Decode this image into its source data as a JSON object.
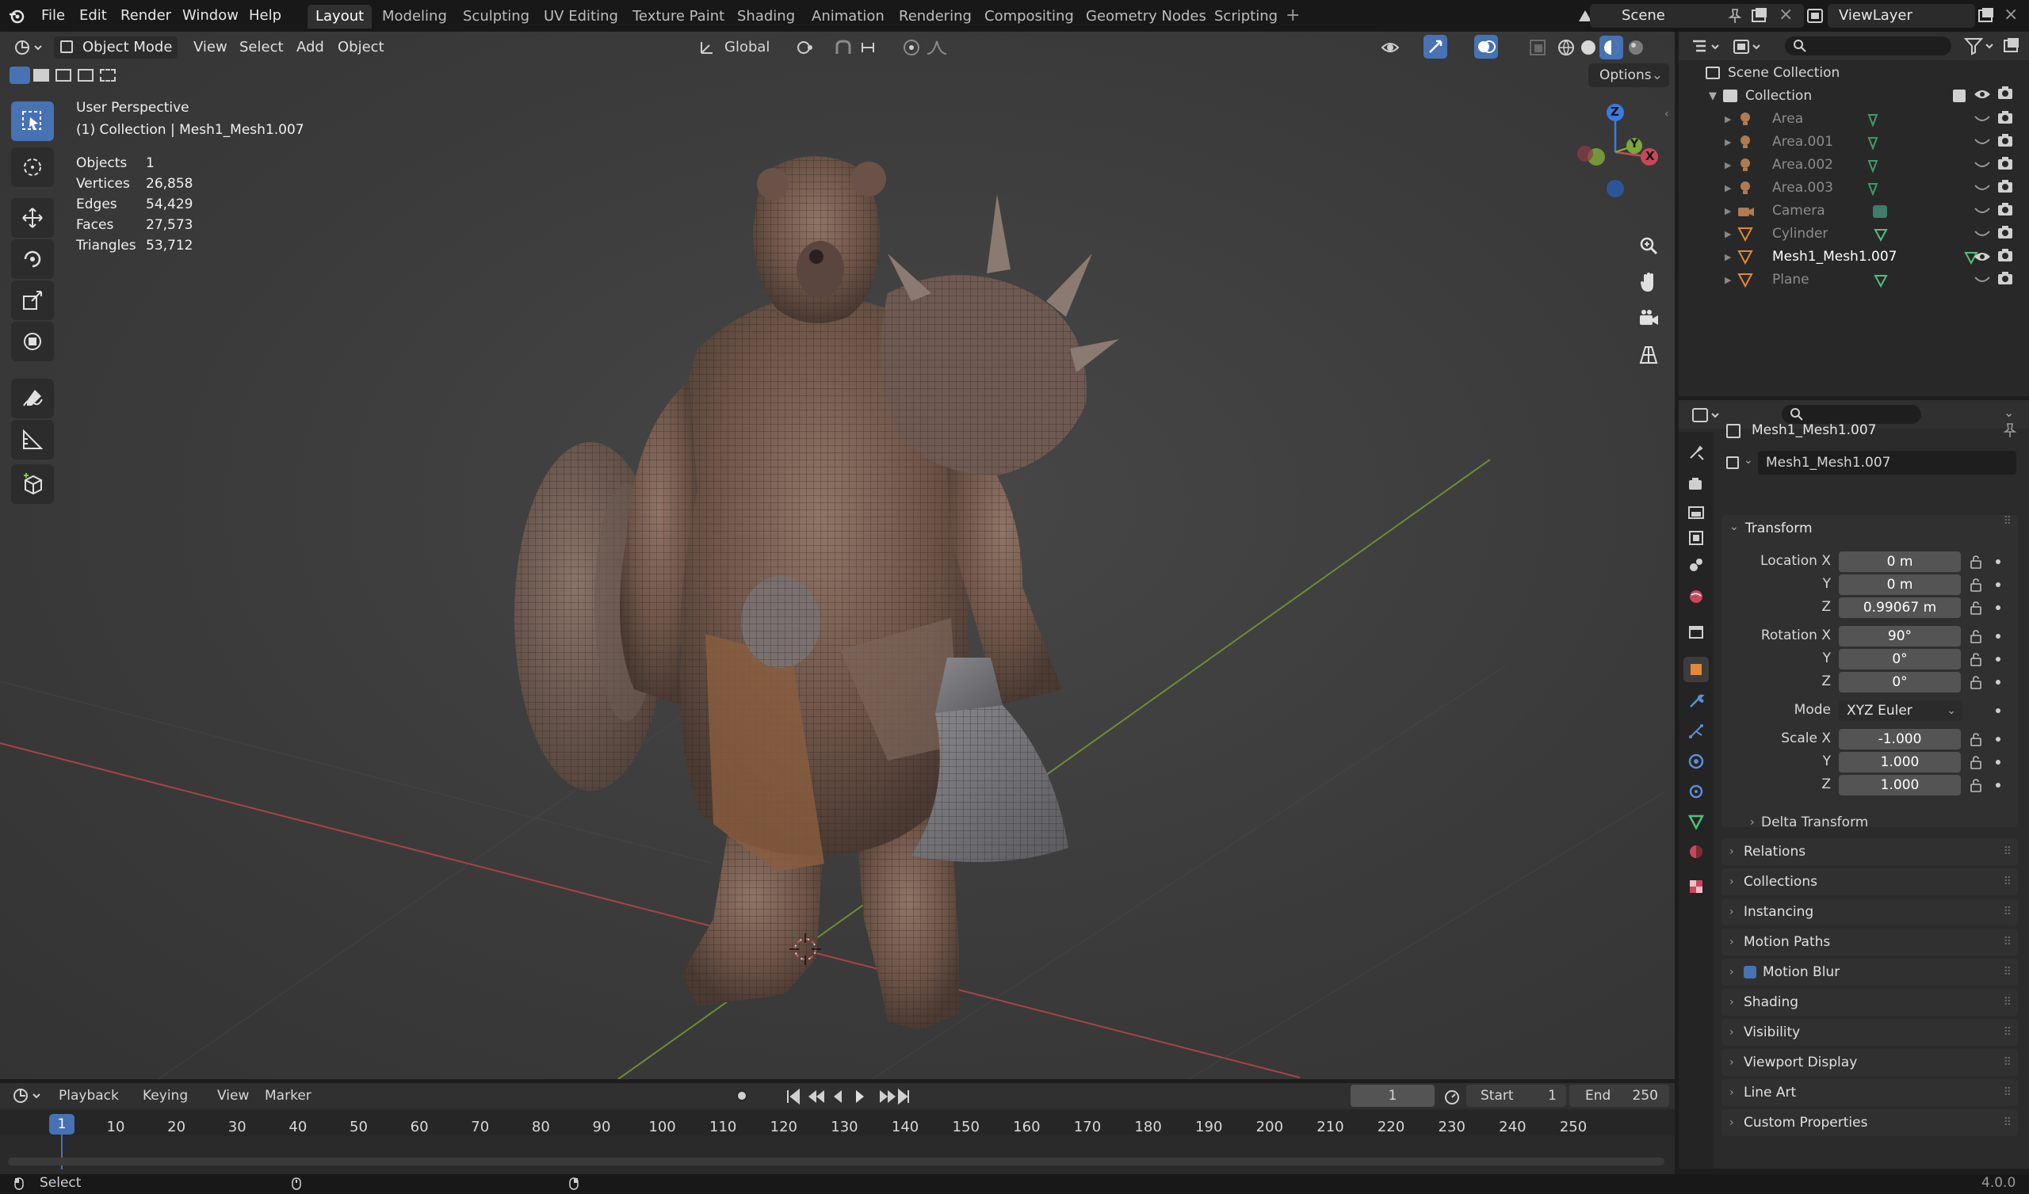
{
  "menu": {
    "file": "File",
    "edit": "Edit",
    "render": "Render",
    "window": "Window",
    "help": "Help"
  },
  "workspaces": [
    "Layout",
    "Modeling",
    "Sculpting",
    "UV Editing",
    "Texture Paint",
    "Shading",
    "Animation",
    "Rendering",
    "Compositing",
    "Geometry Nodes",
    "Scripting"
  ],
  "active_workspace": "Layout",
  "scene": {
    "label": "Scene"
  },
  "view_layer": {
    "label": "ViewLayer"
  },
  "viewport": {
    "mode": "Object Mode",
    "menus": [
      "View",
      "Select",
      "Add",
      "Object"
    ],
    "orientation": "Global",
    "options_label": "Options",
    "overlay_title": "User Perspective",
    "overlay_sub": "(1) Collection | Mesh1_Mesh1.007",
    "stats": [
      {
        "label": "Objects",
        "value": "1"
      },
      {
        "label": "Vertices",
        "value": "26,858"
      },
      {
        "label": "Edges",
        "value": "54,429"
      },
      {
        "label": "Faces",
        "value": "27,573"
      },
      {
        "label": "Triangles",
        "value": "53,712"
      }
    ],
    "gizmo": {
      "x": "X",
      "y": "Y",
      "z": "Z"
    }
  },
  "outliner": {
    "root": "Scene Collection",
    "collection": "Collection",
    "items": [
      {
        "name": "Area",
        "type": "light"
      },
      {
        "name": "Area.001",
        "type": "light"
      },
      {
        "name": "Area.002",
        "type": "light"
      },
      {
        "name": "Area.003",
        "type": "light"
      },
      {
        "name": "Camera",
        "type": "camera"
      },
      {
        "name": "Cylinder",
        "type": "mesh"
      },
      {
        "name": "Mesh1_Mesh1.007",
        "type": "mesh",
        "active": true
      },
      {
        "name": "Plane",
        "type": "mesh"
      }
    ]
  },
  "properties": {
    "object_name": "Mesh1_Mesh1.007",
    "data_name": "Mesh1_Mesh1.007",
    "transform_label": "Transform",
    "location": {
      "label": "Location X",
      "x": "0 m",
      "y": "0 m",
      "z": "0.99067 m"
    },
    "rotation": {
      "label": "Rotation X",
      "x": "90°",
      "y": "0°",
      "z": "0°"
    },
    "mode": {
      "label": "Mode",
      "value": "XYZ Euler"
    },
    "scale": {
      "label": "Scale X",
      "x": "-1.000",
      "y": "1.000",
      "z": "1.000"
    },
    "axis_y": "Y",
    "axis_z": "Z",
    "delta_transform": "Delta Transform",
    "panels": [
      "Relations",
      "Collections",
      "Instancing",
      "Motion Paths",
      "Motion Blur",
      "Shading",
      "Visibility",
      "Viewport Display",
      "Line Art",
      "Custom Properties"
    ]
  },
  "timeline": {
    "menus": [
      "Playback",
      "Keying",
      "View",
      "Marker"
    ],
    "current_frame": "1",
    "start_label": "Start",
    "start": "1",
    "end_label": "End",
    "end": "250",
    "ticks": [
      "1",
      "10",
      "20",
      "30",
      "40",
      "50",
      "60",
      "70",
      "80",
      "90",
      "100",
      "110",
      "120",
      "130",
      "140",
      "150",
      "160",
      "170",
      "180",
      "190",
      "200",
      "210",
      "220",
      "230",
      "240",
      "250"
    ]
  },
  "status": {
    "select": "Select",
    "version": "4.0.0"
  },
  "colors": {
    "accent": "#4772b3",
    "x_axis": "#c8485a",
    "y_axis": "#7fa63a",
    "z_axis": "#3a7be0"
  }
}
